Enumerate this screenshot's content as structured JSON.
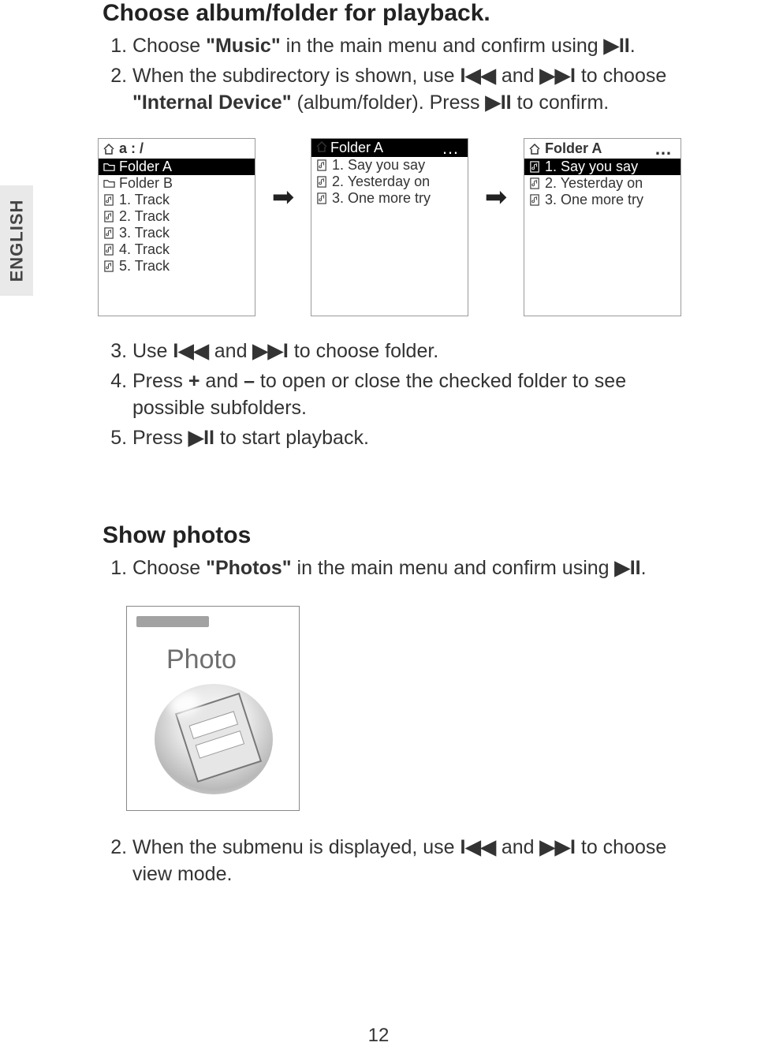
{
  "language_tab": "ENGLISH",
  "section1": {
    "title": "Choose album/folder for playback.",
    "steps": [
      {
        "pre": "Choose ",
        "bold": "\"Music\"",
        "post": " in the main menu and confirm using ",
        "sym": "▶II",
        "post2": "."
      },
      {
        "pre": "When the subdirectory is shown, use  ",
        "bold": "I◀◀",
        "mid": " and ",
        "bold2": "▶▶I",
        "post": " to choose ",
        "bold3": "\"Internal Device\"",
        "post2": " (album/folder). Press ",
        "sym": "▶II",
        "post3": " to confirm."
      }
    ],
    "frames": {
      "f1": {
        "header": "a : /",
        "rows": [
          {
            "text": "Folder A",
            "sel": true,
            "icon": "folder"
          },
          {
            "text": "Folder B",
            "sel": false,
            "icon": "folder"
          },
          {
            "text": "1. Track",
            "sel": false,
            "icon": "note"
          },
          {
            "text": "2. Track",
            "sel": false,
            "icon": "note"
          },
          {
            "text": "3. Track",
            "sel": false,
            "icon": "note"
          },
          {
            "text": "4. Track",
            "sel": false,
            "icon": "note"
          },
          {
            "text": "5. Track",
            "sel": false,
            "icon": "note"
          }
        ]
      },
      "f2": {
        "header": "Folder A",
        "rows": [
          {
            "text": "1. Say you say",
            "sel": false,
            "icon": "note"
          },
          {
            "text": "2. Yesterday on",
            "sel": false,
            "icon": "note"
          },
          {
            "text": "3. One more try",
            "sel": false,
            "icon": "note"
          }
        ]
      },
      "f3": {
        "header": "Folder A",
        "rows": [
          {
            "text": "1. Say you say",
            "sel": true,
            "icon": "note"
          },
          {
            "text": "2. Yesterday on",
            "sel": false,
            "icon": "note"
          },
          {
            "text": "3. One more try",
            "sel": false,
            "icon": "note"
          }
        ]
      }
    },
    "steps2": [
      {
        "pre": "Use ",
        "bold": "I◀◀",
        "mid": " and ",
        "bold2": "▶▶I",
        "post": " to choose folder."
      },
      {
        "pre": "Press ",
        "bold": "+",
        "mid": " and ",
        "bold2": "–",
        "post": " to open or close the checked folder to see possible subfolders."
      },
      {
        "pre": "Press ",
        "sym": "▶II",
        "post": " to start playback."
      }
    ]
  },
  "section2": {
    "title": "Show photos",
    "steps": [
      {
        "pre": "Choose ",
        "bold": "\"Photos\"",
        "post": " in the main menu and confirm using ",
        "sym": "▶II",
        "post2": "."
      }
    ],
    "photo_label": "Photo",
    "steps2": [
      {
        "pre": "When the submenu is displayed, use ",
        "bold": "I◀◀",
        "mid": " and ",
        "bold2": "▶▶I",
        "post": " to choose view mode."
      }
    ]
  },
  "page_number": "12"
}
